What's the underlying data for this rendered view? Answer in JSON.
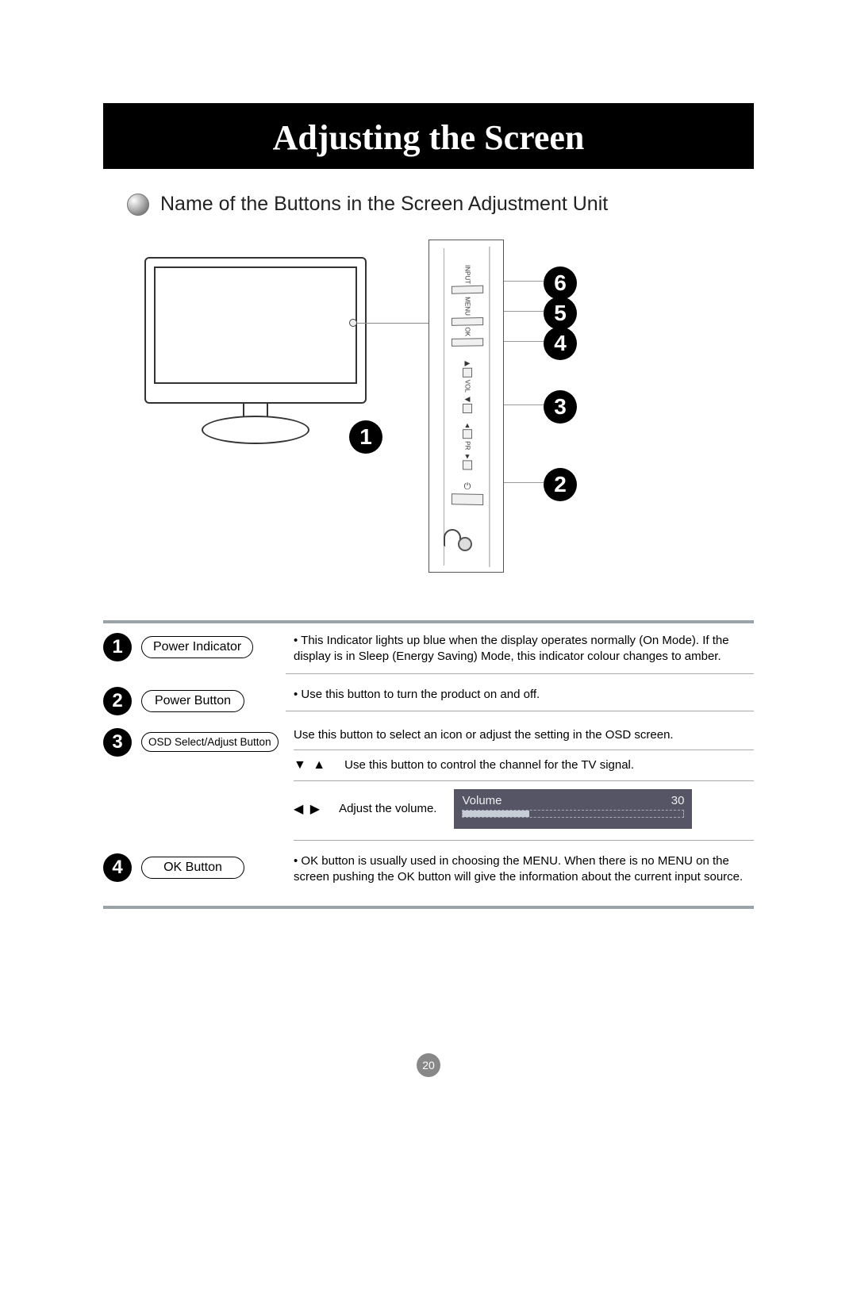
{
  "title": "Adjusting the Screen",
  "subtitle": "Name of the Buttons in the Screen Adjustment Unit",
  "panel_labels": {
    "input": "INPUT",
    "menu": "MENU",
    "ok": "OK",
    "vol": "VOL",
    "pr": "PR"
  },
  "callouts": {
    "c1": "1",
    "c2": "2",
    "c3": "3",
    "c4": "4",
    "c5": "5",
    "c6": "6"
  },
  "rows": {
    "r1": {
      "num": "1",
      "label": "Power Indicator",
      "desc": "This Indicator lights up blue when the display operates normally (On Mode). If the display is in Sleep (Energy Saving) Mode, this indicator colour changes to amber."
    },
    "r2": {
      "num": "2",
      "label": "Power Button",
      "desc": "Use this button to turn the product on and off."
    },
    "r3": {
      "num": "3",
      "label": "OSD Select/Adjust Button",
      "desc_a": "Use this button to select an icon or adjust the setting in the OSD screen.",
      "desc_b": "Use this button to control the channel for the TV signal.",
      "desc_c": "Adjust the volume.",
      "tri_up_down": "▼ ▲",
      "tri_left_right": "◀ ▶",
      "volume_label": "Volume",
      "volume_value": "30"
    },
    "r4": {
      "num": "4",
      "label": "OK Button",
      "desc": "OK button is usually used in choosing the MENU. When there is no MENU on the screen pushing the OK button will give the information about the current input source."
    }
  },
  "page_number": "20"
}
